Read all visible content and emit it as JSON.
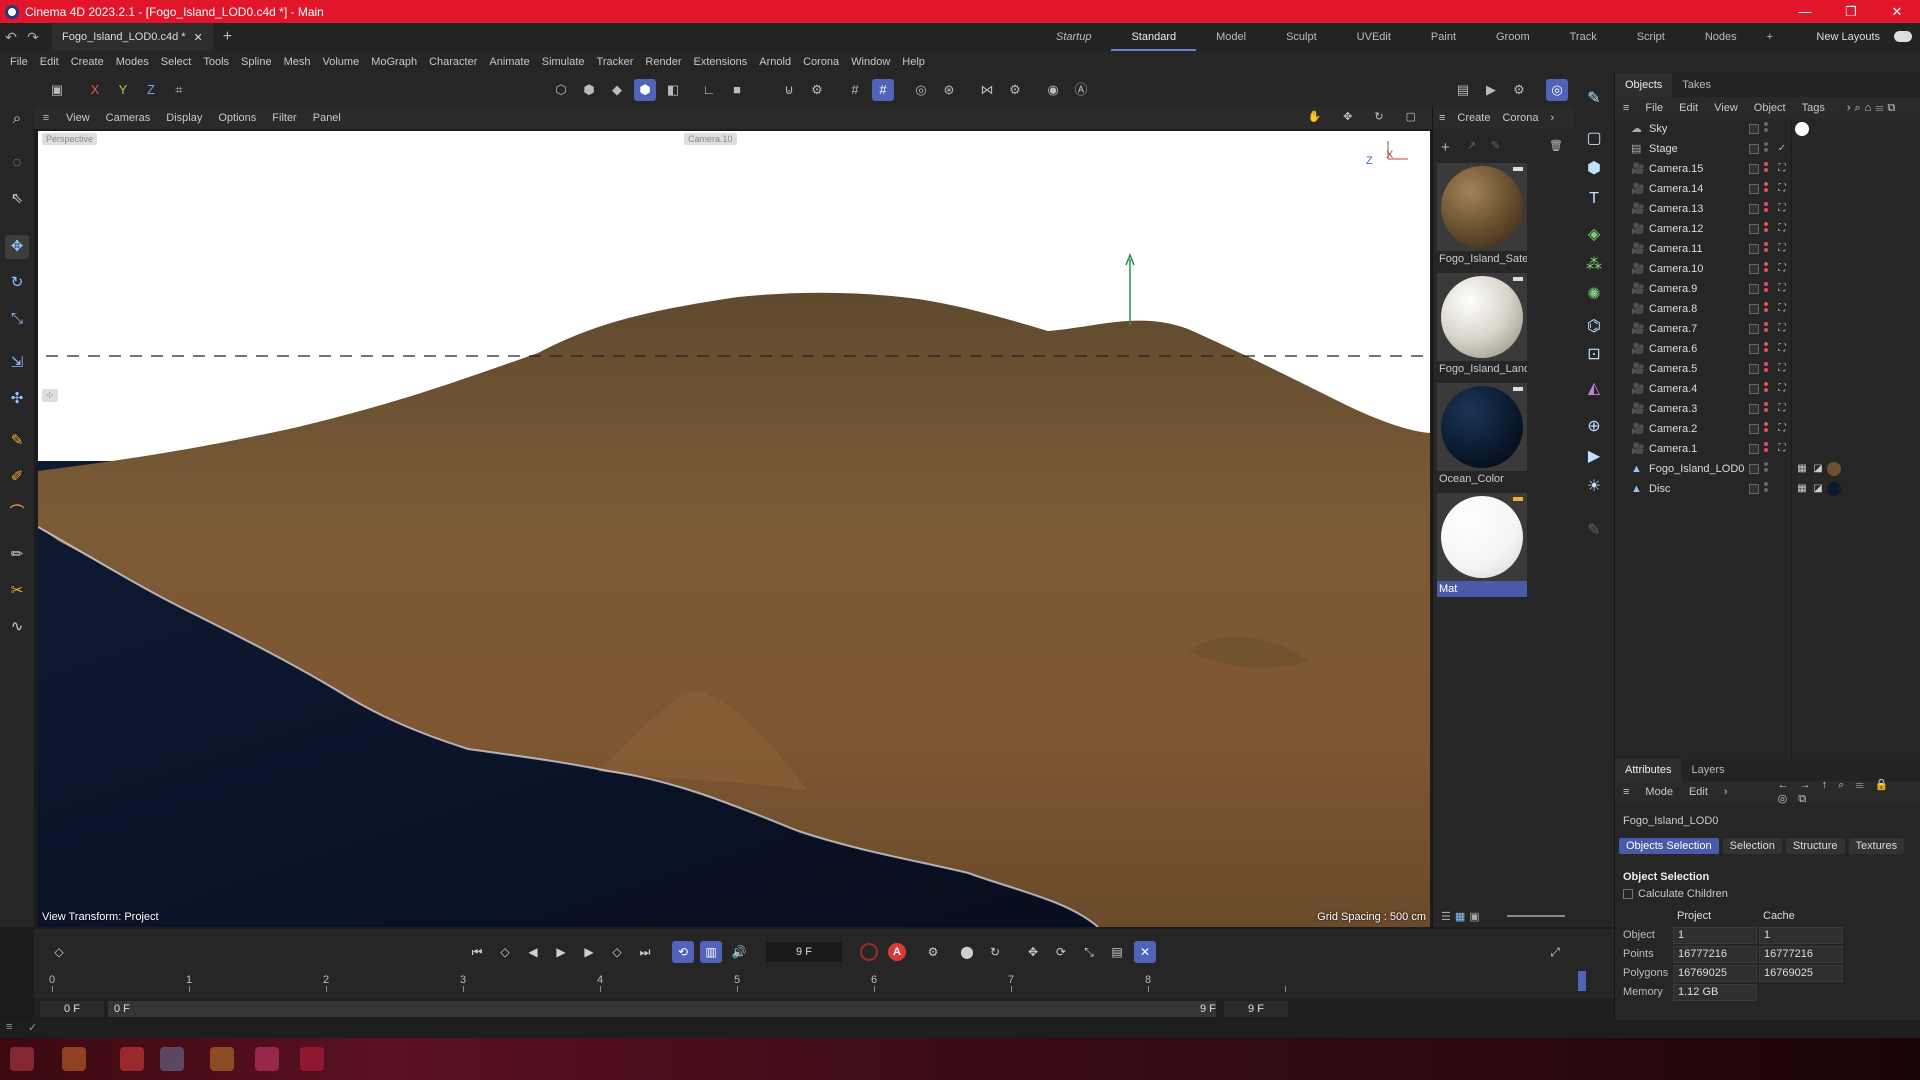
{
  "window": {
    "title": "Cinema 4D 2023.2.1 - [Fogo_Island_LOD0.c4d *] - Main",
    "controls": [
      "—",
      "❐",
      "✕"
    ]
  },
  "tabs": {
    "doc_tab": "Fogo_Island_LOD0.c4d *",
    "layouts": [
      "Startup",
      "Standard",
      "Model",
      "Sculpt",
      "UVEdit",
      "Paint",
      "Groom",
      "Track",
      "Script",
      "Nodes"
    ],
    "active_layout": "Standard",
    "new_layouts": "New Layouts"
  },
  "menu": [
    "File",
    "Edit",
    "Create",
    "Modes",
    "Select",
    "Tools",
    "Spline",
    "Mesh",
    "Volume",
    "MoGraph",
    "Character",
    "Animate",
    "Simulate",
    "Tracker",
    "Render",
    "Extensions",
    "Arnold",
    "Corona",
    "Window",
    "Help"
  ],
  "axis_lock": {
    "x": "X",
    "y": "Y",
    "z": "Z"
  },
  "viewport": {
    "menu": [
      "View",
      "Cameras",
      "Display",
      "Options",
      "Filter",
      "Panel"
    ],
    "chip_left": "Perspective",
    "chip_center": "Camera.10",
    "view_transform": "View Transform: Project",
    "grid_spacing": "Grid Spacing : 500 cm",
    "axis_z": "Z",
    "axis_x": "X",
    "colors": {
      "ocean": "#0b1428",
      "terrain": "#7a5a36",
      "sky": "#ffffff"
    }
  },
  "materials": {
    "menu": [
      "Create",
      "Corona"
    ],
    "items": [
      {
        "name": "Fogo_Island_Satel",
        "color": "#6a5230"
      },
      {
        "name": "Fogo_Island_Land",
        "color": "#d8d4c8"
      },
      {
        "name": "Ocean_Color",
        "color": "#0b1a2e"
      },
      {
        "name": "Mat",
        "color": "#ffffff"
      }
    ],
    "selected": "Mat"
  },
  "objects": {
    "tabs": [
      "Objects",
      "Takes"
    ],
    "menu": [
      "File",
      "Edit",
      "View",
      "Object",
      "Tags"
    ],
    "items": [
      {
        "name": "Sky",
        "icon": "sky-icon"
      },
      {
        "name": "Stage",
        "icon": "stage-icon"
      },
      {
        "name": "Camera.15",
        "icon": "camera-icon"
      },
      {
        "name": "Camera.14",
        "icon": "camera-icon"
      },
      {
        "name": "Camera.13",
        "icon": "camera-icon"
      },
      {
        "name": "Camera.12",
        "icon": "camera-icon"
      },
      {
        "name": "Camera.11",
        "icon": "camera-icon"
      },
      {
        "name": "Camera.10",
        "icon": "camera-icon"
      },
      {
        "name": "Camera.9",
        "icon": "camera-icon"
      },
      {
        "name": "Camera.8",
        "icon": "camera-icon"
      },
      {
        "name": "Camera.7",
        "icon": "camera-icon"
      },
      {
        "name": "Camera.6",
        "icon": "camera-icon"
      },
      {
        "name": "Camera.5",
        "icon": "camera-icon"
      },
      {
        "name": "Camera.4",
        "icon": "camera-icon"
      },
      {
        "name": "Camera.3",
        "icon": "camera-icon"
      },
      {
        "name": "Camera.2",
        "icon": "camera-icon"
      },
      {
        "name": "Camera.1",
        "icon": "camera-icon"
      },
      {
        "name": "Fogo_Island_LOD0",
        "icon": "polygon-object-icon"
      },
      {
        "name": "Disc",
        "icon": "polygon-object-icon"
      }
    ]
  },
  "attributes": {
    "tabs": [
      "Attributes",
      "Layers"
    ],
    "menu": [
      "Mode",
      "Edit"
    ],
    "object_name": "Fogo_Island_LOD0",
    "subtabs": [
      "Objects Selection",
      "Selection",
      "Structure",
      "Textures"
    ],
    "active_subtab": "Objects Selection",
    "section": "Object Selection",
    "calculate_children": "Calculate Children",
    "columns": [
      "Project",
      "Cache"
    ],
    "rows": [
      {
        "label": "Object",
        "project": "1",
        "cache": "1"
      },
      {
        "label": "Points",
        "project": "16777216",
        "cache": "16777216"
      },
      {
        "label": "Polygons",
        "project": "16769025",
        "cache": "16769025"
      },
      {
        "label": "Memory",
        "project": "1.12 GB",
        "cache": ""
      }
    ]
  },
  "transport": {
    "current_frame": "9 F",
    "record_label": "A"
  },
  "timeline": {
    "ticks": [
      "0",
      "1",
      "2",
      "3",
      "4",
      "5",
      "6",
      "7",
      "8",
      "9"
    ],
    "start": "0 F",
    "range_start": "0 F",
    "range_end": "9 F",
    "end": "9 F"
  }
}
